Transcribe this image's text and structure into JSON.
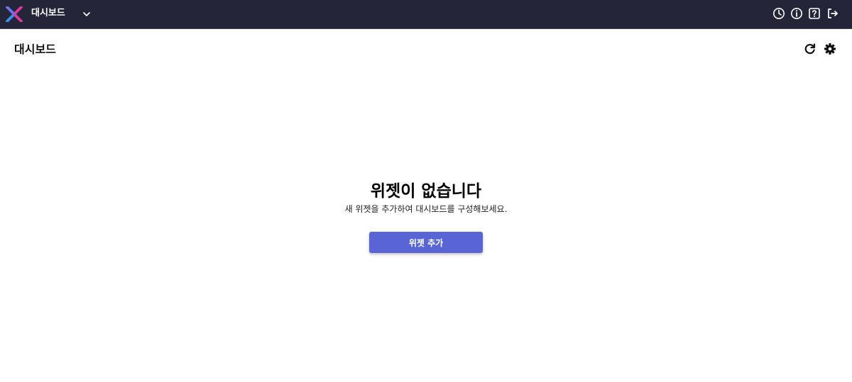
{
  "colors": {
    "topbar_bg": "#252539",
    "accent": "#5964d5",
    "icon_light": "#ffffff",
    "icon_dark": "#111111"
  },
  "header": {
    "app_title": "대시보드",
    "icons": [
      "app-logo",
      "chevron-down-icon",
      "clock-icon",
      "info-icon",
      "help-icon",
      "logout-icon"
    ]
  },
  "page": {
    "title": "대시보드",
    "icons": [
      "refresh-icon",
      "gear-icon"
    ]
  },
  "empty_state": {
    "title": "위젯이 없습니다",
    "description": "새 위젯을 추가하여 대시보드를 구성해보세요.",
    "button_label": "위젯 추가"
  }
}
